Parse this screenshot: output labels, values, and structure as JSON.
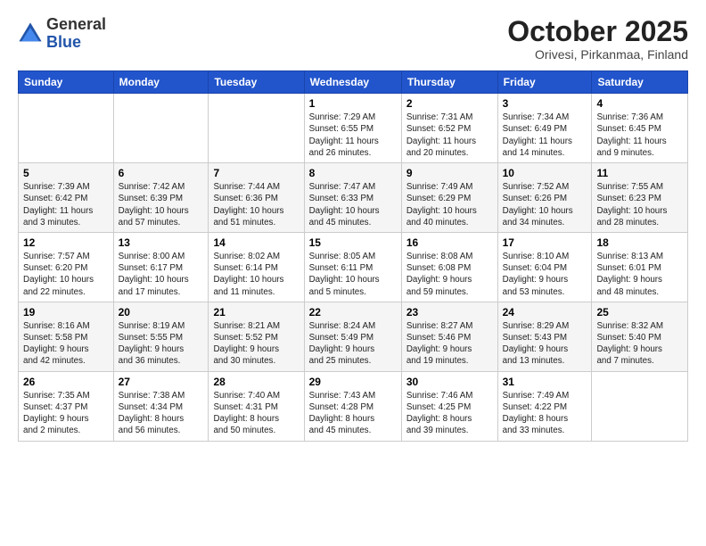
{
  "logo": {
    "general": "General",
    "blue": "Blue"
  },
  "header": {
    "month": "October 2025",
    "location": "Orivesi, Pirkanmaa, Finland"
  },
  "weekdays": [
    "Sunday",
    "Monday",
    "Tuesday",
    "Wednesday",
    "Thursday",
    "Friday",
    "Saturday"
  ],
  "weeks": [
    [
      {
        "day": "",
        "info": ""
      },
      {
        "day": "",
        "info": ""
      },
      {
        "day": "",
        "info": ""
      },
      {
        "day": "1",
        "info": "Sunrise: 7:29 AM\nSunset: 6:55 PM\nDaylight: 11 hours\nand 26 minutes."
      },
      {
        "day": "2",
        "info": "Sunrise: 7:31 AM\nSunset: 6:52 PM\nDaylight: 11 hours\nand 20 minutes."
      },
      {
        "day": "3",
        "info": "Sunrise: 7:34 AM\nSunset: 6:49 PM\nDaylight: 11 hours\nand 14 minutes."
      },
      {
        "day": "4",
        "info": "Sunrise: 7:36 AM\nSunset: 6:45 PM\nDaylight: 11 hours\nand 9 minutes."
      }
    ],
    [
      {
        "day": "5",
        "info": "Sunrise: 7:39 AM\nSunset: 6:42 PM\nDaylight: 11 hours\nand 3 minutes."
      },
      {
        "day": "6",
        "info": "Sunrise: 7:42 AM\nSunset: 6:39 PM\nDaylight: 10 hours\nand 57 minutes."
      },
      {
        "day": "7",
        "info": "Sunrise: 7:44 AM\nSunset: 6:36 PM\nDaylight: 10 hours\nand 51 minutes."
      },
      {
        "day": "8",
        "info": "Sunrise: 7:47 AM\nSunset: 6:33 PM\nDaylight: 10 hours\nand 45 minutes."
      },
      {
        "day": "9",
        "info": "Sunrise: 7:49 AM\nSunset: 6:29 PM\nDaylight: 10 hours\nand 40 minutes."
      },
      {
        "day": "10",
        "info": "Sunrise: 7:52 AM\nSunset: 6:26 PM\nDaylight: 10 hours\nand 34 minutes."
      },
      {
        "day": "11",
        "info": "Sunrise: 7:55 AM\nSunset: 6:23 PM\nDaylight: 10 hours\nand 28 minutes."
      }
    ],
    [
      {
        "day": "12",
        "info": "Sunrise: 7:57 AM\nSunset: 6:20 PM\nDaylight: 10 hours\nand 22 minutes."
      },
      {
        "day": "13",
        "info": "Sunrise: 8:00 AM\nSunset: 6:17 PM\nDaylight: 10 hours\nand 17 minutes."
      },
      {
        "day": "14",
        "info": "Sunrise: 8:02 AM\nSunset: 6:14 PM\nDaylight: 10 hours\nand 11 minutes."
      },
      {
        "day": "15",
        "info": "Sunrise: 8:05 AM\nSunset: 6:11 PM\nDaylight: 10 hours\nand 5 minutes."
      },
      {
        "day": "16",
        "info": "Sunrise: 8:08 AM\nSunset: 6:08 PM\nDaylight: 9 hours\nand 59 minutes."
      },
      {
        "day": "17",
        "info": "Sunrise: 8:10 AM\nSunset: 6:04 PM\nDaylight: 9 hours\nand 53 minutes."
      },
      {
        "day": "18",
        "info": "Sunrise: 8:13 AM\nSunset: 6:01 PM\nDaylight: 9 hours\nand 48 minutes."
      }
    ],
    [
      {
        "day": "19",
        "info": "Sunrise: 8:16 AM\nSunset: 5:58 PM\nDaylight: 9 hours\nand 42 minutes."
      },
      {
        "day": "20",
        "info": "Sunrise: 8:19 AM\nSunset: 5:55 PM\nDaylight: 9 hours\nand 36 minutes."
      },
      {
        "day": "21",
        "info": "Sunrise: 8:21 AM\nSunset: 5:52 PM\nDaylight: 9 hours\nand 30 minutes."
      },
      {
        "day": "22",
        "info": "Sunrise: 8:24 AM\nSunset: 5:49 PM\nDaylight: 9 hours\nand 25 minutes."
      },
      {
        "day": "23",
        "info": "Sunrise: 8:27 AM\nSunset: 5:46 PM\nDaylight: 9 hours\nand 19 minutes."
      },
      {
        "day": "24",
        "info": "Sunrise: 8:29 AM\nSunset: 5:43 PM\nDaylight: 9 hours\nand 13 minutes."
      },
      {
        "day": "25",
        "info": "Sunrise: 8:32 AM\nSunset: 5:40 PM\nDaylight: 9 hours\nand 7 minutes."
      }
    ],
    [
      {
        "day": "26",
        "info": "Sunrise: 7:35 AM\nSunset: 4:37 PM\nDaylight: 9 hours\nand 2 minutes."
      },
      {
        "day": "27",
        "info": "Sunrise: 7:38 AM\nSunset: 4:34 PM\nDaylight: 8 hours\nand 56 minutes."
      },
      {
        "day": "28",
        "info": "Sunrise: 7:40 AM\nSunset: 4:31 PM\nDaylight: 8 hours\nand 50 minutes."
      },
      {
        "day": "29",
        "info": "Sunrise: 7:43 AM\nSunset: 4:28 PM\nDaylight: 8 hours\nand 45 minutes."
      },
      {
        "day": "30",
        "info": "Sunrise: 7:46 AM\nSunset: 4:25 PM\nDaylight: 8 hours\nand 39 minutes."
      },
      {
        "day": "31",
        "info": "Sunrise: 7:49 AM\nSunset: 4:22 PM\nDaylight: 8 hours\nand 33 minutes."
      },
      {
        "day": "",
        "info": ""
      }
    ]
  ]
}
